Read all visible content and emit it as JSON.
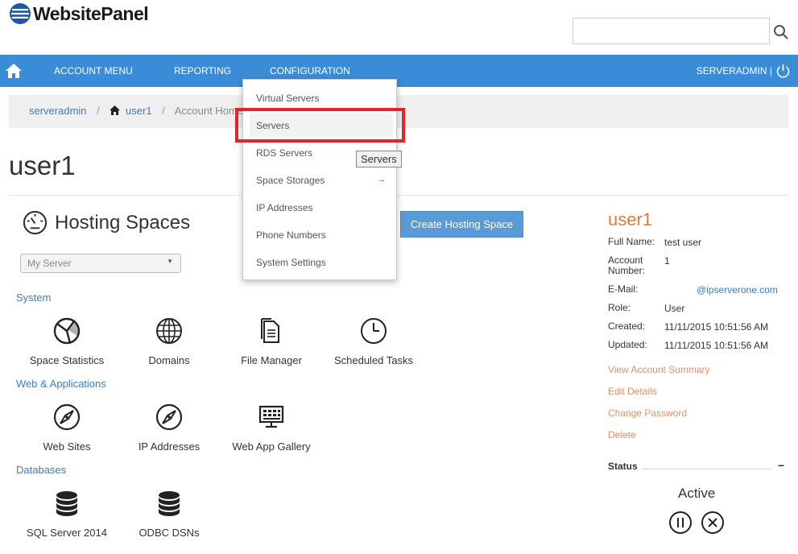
{
  "app": {
    "name": "WebsitePanel"
  },
  "search": {
    "placeholder": ""
  },
  "nav": {
    "items": [
      "ACCOUNT MENU",
      "REPORTING",
      "CONFIGURATION"
    ],
    "user": "SERVERADMIN |"
  },
  "breadcrumb": {
    "root": "serveradmin",
    "user": "user1",
    "current": "Account Home"
  },
  "page": {
    "title": "user1"
  },
  "hosting": {
    "title": "Hosting Spaces",
    "create_label": "Create Hosting Space",
    "server_select": "My Server"
  },
  "sections": {
    "system": {
      "label": "System",
      "items": [
        "Space Statistics",
        "Domains",
        "File Manager",
        "Scheduled Tasks"
      ]
    },
    "web": {
      "label": "Web & Applications",
      "items": [
        "Web Sites",
        "IP Addresses",
        "Web App Gallery"
      ]
    },
    "databases": {
      "label": "Databases",
      "items": [
        "SQL Server 2014",
        "ODBC DSNs"
      ]
    }
  },
  "config_menu": {
    "items": [
      "Virtual Servers",
      "Servers",
      "RDS Servers",
      "Space Storages",
      "IP Addresses",
      "Phone Numbers",
      "System Settings"
    ],
    "submenu_arrow": "→",
    "tooltip": "Servers"
  },
  "account": {
    "name": "user1",
    "full_name_label": "Full Name:",
    "full_name": "test user",
    "account_number_label_1": "Account",
    "account_number_label_2": "Number:",
    "account_number": "1",
    "email_label": "E-Mail:",
    "email": "@ipserverone.com",
    "role_label": "Role:",
    "role": "User",
    "created_label": "Created:",
    "created": "11/11/2015 10:51:56 AM",
    "updated_label": "Updated:",
    "updated": "11/11/2015 10:51:56 AM",
    "links": [
      "View Account Summary",
      "Edit Details",
      "Change Password",
      "Delete"
    ],
    "status_title": "Status",
    "status_collapse": "−",
    "status_value": "Active"
  },
  "colors": {
    "navbar": "#3b8cd7",
    "link": "#3b7cc0",
    "accent_orange": "#e07a3c",
    "highlight_red": "#e0262c"
  }
}
